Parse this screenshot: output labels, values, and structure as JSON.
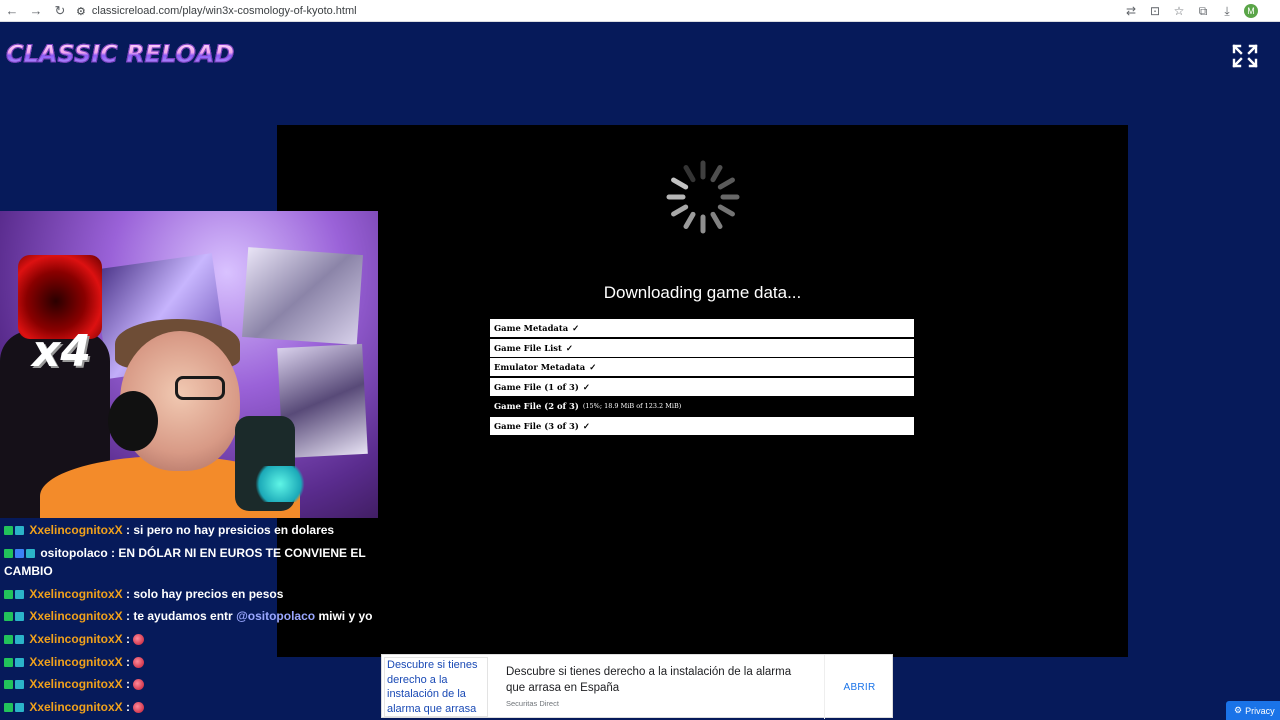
{
  "browser": {
    "url": "classicreload.com/play/win3x-cosmology-of-kyoto.html",
    "profile_initial": "M"
  },
  "site": {
    "logo": "CLASSIC RELOAD"
  },
  "game": {
    "status_title": "Downloading game data...",
    "items": [
      {
        "label": "Game Metadata",
        "state": "✓",
        "done": true
      },
      {
        "label": "Game File List",
        "state": "✓",
        "done": true
      },
      {
        "label": "Emulator Metadata",
        "state": "✓",
        "done": true
      },
      {
        "label": "Game File (1 of 3)",
        "state": "✓",
        "done": true
      },
      {
        "label": "Game File (2 of 3)",
        "state": "(15%; 18.9 MiB of 123.2 MiB)",
        "done": false,
        "progress": 0.15
      },
      {
        "label": "Game File (3 of 3)",
        "state": "✓",
        "done": true
      }
    ]
  },
  "webcam": {
    "overlay_text": "x4"
  },
  "chat": [
    {
      "badges": [
        "green",
        "teal"
      ],
      "user": "XxelincognitoxX",
      "user_color": "orange",
      "parts": [
        " : si pero no hay presicios en dolares"
      ]
    },
    {
      "badges": [
        "green",
        "blue",
        "teal"
      ],
      "user": "ositopolaco",
      "user_color": "white",
      "parts": [
        " : EN DÓLAR NI EN EUROS TE CONVIENE EL CAMBIO"
      ]
    },
    {
      "badges": [
        "green",
        "teal"
      ],
      "user": "XxelincognitoxX",
      "user_color": "orange",
      "parts": [
        " : solo hay precios en pesos"
      ]
    },
    {
      "badges": [
        "green",
        "teal"
      ],
      "user": "XxelincognitoxX",
      "user_color": "orange",
      "parts": [
        " : te ayudamos entr "
      ],
      "mention": "@ositopolaco",
      "after": " miwi y yo"
    },
    {
      "badges": [
        "green",
        "teal"
      ],
      "user": "XxelincognitoxX",
      "user_color": "orange",
      "parts": [
        " : "
      ],
      "emote": true
    },
    {
      "badges": [
        "green",
        "teal"
      ],
      "user": "XxelincognitoxX",
      "user_color": "orange",
      "parts": [
        " : "
      ],
      "emote": true
    },
    {
      "badges": [
        "green",
        "teal"
      ],
      "user": "XxelincognitoxX",
      "user_color": "orange",
      "parts": [
        " : "
      ],
      "emote": true
    },
    {
      "badges": [
        "green",
        "teal"
      ],
      "user": "XxelincognitoxX",
      "user_color": "orange",
      "parts": [
        " : "
      ],
      "emote": true
    }
  ],
  "ad": {
    "image_alt": "Descubre si tienes derecho a la instalación de la alarma que arrasa",
    "headline": "Descubre si tienes derecho a la instalación de la alarma que arrasa en España",
    "source": "Securitas Direct",
    "cta": "ABRIR"
  },
  "privacy": {
    "label": "Privacy"
  },
  "colors": {
    "page_bg": "#061a5a",
    "user_orange": "#f0a11c",
    "mention": "#9aa7ff"
  }
}
